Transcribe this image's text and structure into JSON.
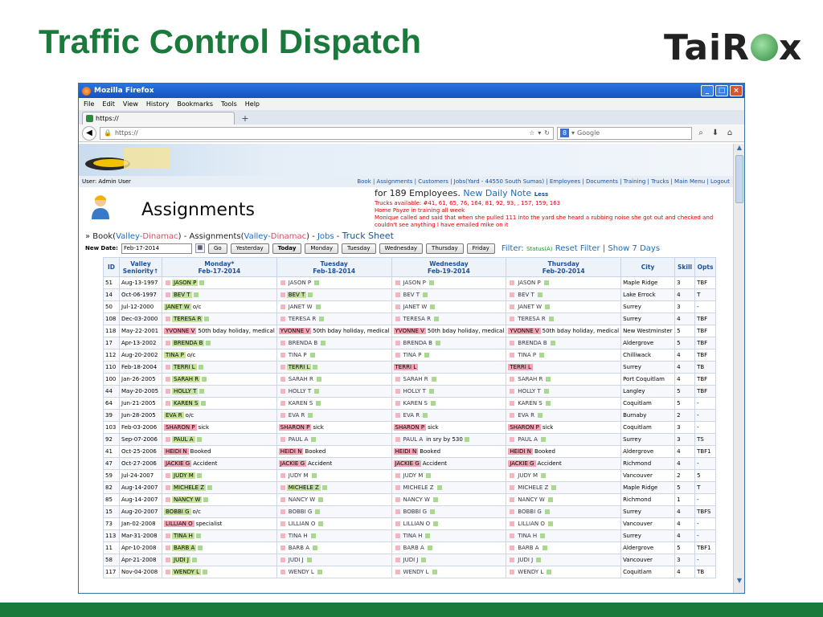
{
  "slide": {
    "title": "Traffic Control Dispatch",
    "brand": [
      "Tai",
      "R",
      "x"
    ]
  },
  "browser": {
    "window_title": "Mozilla Firefox",
    "menu": [
      "File",
      "Edit",
      "View",
      "History",
      "Bookmarks",
      "Tools",
      "Help"
    ],
    "tab_label": "https://",
    "url": "https://",
    "search_placeholder": "Google"
  },
  "app": {
    "user": "User: Admin User",
    "nav_links": "Book | Assignments | Customers | Jobs(Yard - 44550 South Sumas) | Employees | Documents | Training | Trucks | Main Menu | Logout",
    "page_title": "Assignments",
    "employees_text": "for 189 Employees.",
    "new_note": "New Daily Note",
    "less": "Less",
    "notes": [
      "Trucks available: #41, 61, 65, 76, 164, 81, 92, 93, , 157, 159, 163",
      "Home Payze in training all week",
      "Monique called and said that when she pulled 111 into the yard she heard a rubbing noise she got out and checked and couldn't see anything I have emailed mike on it"
    ],
    "crumbs": {
      "prefix": "» Book(",
      "org1": "Valley-",
      "org1b": "Dinamac",
      "mid": ") - Assignments(",
      "org2": "Valley-",
      "org2b": "Dinamac",
      "jobs_sep": ") - ",
      "jobs": "Jobs",
      "truck_sep": " - ",
      "truck": "Truck Sheet"
    },
    "date_label": "New Date:",
    "date_value": "Feb-17-2014",
    "buttons": [
      "Go",
      "Yesterday",
      "Today",
      "Monday",
      "Tuesday",
      "Wednesday",
      "Thursday",
      "Friday"
    ],
    "filter_label": "Filter:",
    "filter_status": "Status(A)",
    "reset_filter": "Reset Filter",
    "sep": "|",
    "show_days": "Show 7 Days"
  },
  "table": {
    "headers": {
      "id": "ID",
      "seniority": [
        "Valley",
        "Seniority↑"
      ],
      "days": [
        [
          "Monday*",
          "Feb-17-2014"
        ],
        [
          "Tuesday",
          "Feb-18-2014"
        ],
        [
          "Wednesday",
          "Feb-19-2014"
        ],
        [
          "Thursday",
          "Feb-20-2014"
        ]
      ],
      "city": "City",
      "skill": "Skill",
      "opts": "Opts"
    },
    "rows": [
      {
        "id": "51",
        "date": "Aug-13-1997",
        "days": [
          [
            "JASON P",
            "g",
            "",
            "pm"
          ],
          [
            "JASON P",
            "w",
            "",
            "pm"
          ],
          [
            "JASON P",
            "w",
            "",
            "pm"
          ],
          [
            "JASON P",
            "w",
            "",
            "pm"
          ]
        ],
        "city": "Maple Ridge",
        "skill": "3",
        "opts": "TBF"
      },
      {
        "id": "14",
        "date": "Oct-06-1997",
        "days": [
          [
            "BEV T",
            "g",
            "",
            "pm"
          ],
          [
            "BEV T",
            "g",
            "",
            "pm"
          ],
          [
            "BEV T",
            "w",
            "",
            "pm"
          ],
          [
            "BEV T",
            "w",
            "",
            "pm"
          ]
        ],
        "city": "Lake Errock",
        "skill": "4",
        "opts": "T"
      },
      {
        "id": "50",
        "date": "Jul-12-2000",
        "days": [
          [
            "JANET W",
            "g",
            "o/c",
            ""
          ],
          [
            "JANET W",
            "w",
            "",
            "pm"
          ],
          [
            "JANET W",
            "w",
            "",
            "pm"
          ],
          [
            "JANET W",
            "w",
            "",
            "pm"
          ]
        ],
        "city": "Surrey",
        "skill": "3",
        "opts": "-"
      },
      {
        "id": "108",
        "date": "Dec-03-2000",
        "days": [
          [
            "TERESA R",
            "g",
            "",
            "pm"
          ],
          [
            "TERESA R",
            "w",
            "",
            "pm"
          ],
          [
            "TERESA R",
            "w",
            "",
            "pm"
          ],
          [
            "TERESA R",
            "w",
            "",
            "pm"
          ]
        ],
        "city": "Surrey",
        "skill": "4",
        "opts": "TBF"
      },
      {
        "id": "118",
        "date": "May-22-2001",
        "days": [
          [
            "YVONNE V",
            "p",
            "50th bday holiday, medical",
            ""
          ],
          [
            "YVONNE V",
            "p",
            "50th bday holiday, medical",
            ""
          ],
          [
            "YVONNE V",
            "p",
            "50th bday holiday, medical",
            ""
          ],
          [
            "YVONNE V",
            "p",
            "50th bday holiday, medical",
            ""
          ]
        ],
        "city": "New Westminster",
        "skill": "5",
        "opts": "TBF"
      },
      {
        "id": "17",
        "date": "Apr-13-2002",
        "days": [
          [
            "BRENDA B",
            "g",
            "",
            "pm"
          ],
          [
            "BRENDA B",
            "w",
            "",
            "pm"
          ],
          [
            "BRENDA B",
            "w",
            "",
            "pm"
          ],
          [
            "BRENDA B",
            "w",
            "",
            "pm"
          ]
        ],
        "city": "Aldergrove",
        "skill": "5",
        "opts": "TBF"
      },
      {
        "id": "112",
        "date": "Aug-20-2002",
        "days": [
          [
            "TINA P",
            "g",
            "o/c",
            ""
          ],
          [
            "TINA P",
            "w",
            "",
            "pm"
          ],
          [
            "TINA P",
            "w",
            "",
            "pm"
          ],
          [
            "TINA P",
            "w",
            "",
            "pm"
          ]
        ],
        "city": "Chilliwack",
        "skill": "4",
        "opts": "TBF"
      },
      {
        "id": "110",
        "date": "Feb-18-2004",
        "days": [
          [
            "TERRI L",
            "g",
            "",
            "pm"
          ],
          [
            "TERRI L",
            "g",
            "",
            "pm"
          ],
          [
            "TERRI L",
            "p",
            "",
            ""
          ],
          [
            "TERRI L",
            "p",
            "",
            ""
          ]
        ],
        "city": "Surrey",
        "skill": "4",
        "opts": "TB"
      },
      {
        "id": "100",
        "date": "Jan-26-2005",
        "days": [
          [
            "SARAH R",
            "g",
            "",
            "pm"
          ],
          [
            "SARAH R",
            "w",
            "",
            "pm"
          ],
          [
            "SARAH R",
            "w",
            "",
            "pm"
          ],
          [
            "SARAH R",
            "w",
            "",
            "pm"
          ]
        ],
        "city": "Port Coquitlam",
        "skill": "4",
        "opts": "TBF"
      },
      {
        "id": "44",
        "date": "May-20-2005",
        "days": [
          [
            "HOLLY T",
            "g",
            "",
            "pm"
          ],
          [
            "HOLLY T",
            "w",
            "",
            "pm"
          ],
          [
            "HOLLY T",
            "w",
            "",
            "pm"
          ],
          [
            "HOLLY T",
            "w",
            "",
            "pm"
          ]
        ],
        "city": "Langley",
        "skill": "5",
        "opts": "TBF"
      },
      {
        "id": "64",
        "date": "Jun-21-2005",
        "days": [
          [
            "KAREN S",
            "g",
            "",
            "pm"
          ],
          [
            "KAREN S",
            "w",
            "",
            "pm"
          ],
          [
            "KAREN S",
            "w",
            "",
            "pm"
          ],
          [
            "KAREN S",
            "w",
            "",
            "pm"
          ]
        ],
        "city": "Coquitlam",
        "skill": "5",
        "opts": "-"
      },
      {
        "id": "39",
        "date": "Jun-28-2005",
        "days": [
          [
            "EVA R",
            "g",
            "o/c",
            ""
          ],
          [
            "EVA R",
            "w",
            "",
            "pm"
          ],
          [
            "EVA R",
            "w",
            "",
            "pm"
          ],
          [
            "EVA R",
            "w",
            "",
            "pm"
          ]
        ],
        "city": "Burnaby",
        "skill": "2",
        "opts": "-"
      },
      {
        "id": "103",
        "date": "Feb-03-2006",
        "days": [
          [
            "SHARON P",
            "p",
            "sick",
            ""
          ],
          [
            "SHARON P",
            "p",
            "sick",
            ""
          ],
          [
            "SHARON P",
            "p",
            "sick",
            ""
          ],
          [
            "SHARON P",
            "p",
            "sick",
            ""
          ]
        ],
        "city": "Coquitlam",
        "skill": "3",
        "opts": "-"
      },
      {
        "id": "92",
        "date": "Sep-07-2006",
        "days": [
          [
            "PAUL A",
            "g",
            "",
            "pm"
          ],
          [
            "PAUL A",
            "w",
            "",
            "pm"
          ],
          [
            "PAUL A",
            "w",
            "in sry by 530",
            "pm"
          ],
          [
            "PAUL A",
            "w",
            "",
            "pm"
          ]
        ],
        "city": "Surrey",
        "skill": "3",
        "opts": "TS"
      },
      {
        "id": "41",
        "date": "Oct-25-2006",
        "days": [
          [
            "HEIDI N",
            "p",
            "Booked",
            ""
          ],
          [
            "HEIDI N",
            "p",
            "Booked",
            ""
          ],
          [
            "HEIDI N",
            "p",
            "Booked",
            ""
          ],
          [
            "HEIDI N",
            "p",
            "Booked",
            ""
          ]
        ],
        "city": "Aldergrove",
        "skill": "4",
        "opts": "TBF1"
      },
      {
        "id": "47",
        "date": "Oct-27-2006",
        "days": [
          [
            "JACKIE G",
            "p",
            "Accident",
            ""
          ],
          [
            "JACKIE G",
            "p",
            "Accident",
            ""
          ],
          [
            "JACKIE G",
            "p",
            "Accident",
            ""
          ],
          [
            "JACKIE G",
            "p",
            "Accident",
            ""
          ]
        ],
        "city": "Richmond",
        "skill": "4",
        "opts": "-"
      },
      {
        "id": "59",
        "date": "Jul-24-2007",
        "days": [
          [
            "JUDY M",
            "g",
            "",
            "pm"
          ],
          [
            "JUDY M",
            "w",
            "",
            "pm"
          ],
          [
            "JUDY M",
            "w",
            "",
            "pm"
          ],
          [
            "JUDY M",
            "w",
            "",
            "pm"
          ]
        ],
        "city": "Vancouver",
        "skill": "2",
        "opts": "5"
      },
      {
        "id": "82",
        "date": "Aug-14-2007",
        "days": [
          [
            "MICHELE Z",
            "g",
            "",
            "pm"
          ],
          [
            "MICHELE Z",
            "g",
            "",
            "pm"
          ],
          [
            "MICHELE Z",
            "w",
            "",
            "pm"
          ],
          [
            "MICHELE Z",
            "w",
            "",
            "pm"
          ]
        ],
        "city": "Maple Ridge",
        "skill": "5",
        "opts": "T"
      },
      {
        "id": "85",
        "date": "Aug-14-2007",
        "days": [
          [
            "NANCY W",
            "g",
            "",
            "pm"
          ],
          [
            "NANCY W",
            "w",
            "",
            "pm"
          ],
          [
            "NANCY W",
            "w",
            "",
            "pm"
          ],
          [
            "NANCY W",
            "w",
            "",
            "pm"
          ]
        ],
        "city": "Richmond",
        "skill": "1",
        "opts": "-"
      },
      {
        "id": "15",
        "date": "Aug-20-2007",
        "days": [
          [
            "BOBBI G",
            "g",
            "o/c",
            ""
          ],
          [
            "BOBBI G",
            "w",
            "",
            "pm"
          ],
          [
            "BOBBI G",
            "w",
            "",
            "pm"
          ],
          [
            "BOBBI G",
            "w",
            "",
            "pm"
          ]
        ],
        "city": "Surrey",
        "skill": "4",
        "opts": "TBFS"
      },
      {
        "id": "73",
        "date": "Jan-02-2008",
        "days": [
          [
            "LILLIAN O",
            "p",
            "specialist",
            ""
          ],
          [
            "LILLIAN O",
            "w",
            "",
            "pm"
          ],
          [
            "LILLIAN O",
            "w",
            "",
            "pm"
          ],
          [
            "LILLIAN O",
            "w",
            "",
            "pm"
          ]
        ],
        "city": "Vancouver",
        "skill": "4",
        "opts": "-"
      },
      {
        "id": "113",
        "date": "Mar-31-2008",
        "days": [
          [
            "TINA H",
            "g",
            "",
            "pm"
          ],
          [
            "TINA H",
            "w",
            "",
            "pm"
          ],
          [
            "TINA H",
            "w",
            "",
            "pm"
          ],
          [
            "TINA H",
            "w",
            "",
            "pm"
          ]
        ],
        "city": "Surrey",
        "skill": "4",
        "opts": "-"
      },
      {
        "id": "11",
        "date": "Apr-10-2008",
        "days": [
          [
            "BARB A",
            "g",
            "",
            "pm"
          ],
          [
            "BARB A",
            "w",
            "",
            "pm"
          ],
          [
            "BARB A",
            "w",
            "",
            "pm"
          ],
          [
            "BARB A",
            "w",
            "",
            "pm"
          ]
        ],
        "city": "Aldergrove",
        "skill": "5",
        "opts": "TBF1"
      },
      {
        "id": "58",
        "date": "Apr-21-2008",
        "days": [
          [
            "JUDI J",
            "g",
            "",
            "pm"
          ],
          [
            "JUDI J",
            "w",
            "",
            "pm"
          ],
          [
            "JUDI J",
            "w",
            "",
            "pm"
          ],
          [
            "JUDI J",
            "w",
            "",
            "pm"
          ]
        ],
        "city": "Vancouver",
        "skill": "3",
        "opts": "-"
      },
      {
        "id": "117",
        "date": "Nov-04-2008",
        "days": [
          [
            "WENDY L",
            "g",
            "",
            "pm"
          ],
          [
            "WENDY L",
            "w",
            "",
            "pm"
          ],
          [
            "WENDY L",
            "w",
            "",
            "pm"
          ],
          [
            "WENDY L",
            "w",
            "",
            "pm"
          ]
        ],
        "city": "Coquitlam",
        "skill": "4",
        "opts": "TB"
      }
    ]
  },
  "colors": {
    "title_green": "#1a7a3c",
    "assigned_green": "#c6e39a",
    "unavailable_pink": "#f4a6b6",
    "link_blue": "#1a6cc4",
    "note_red": "#dd0000"
  }
}
